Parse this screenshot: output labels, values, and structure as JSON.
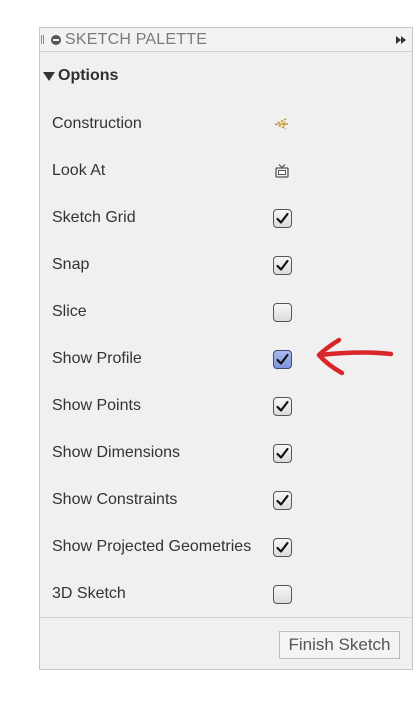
{
  "palette": {
    "title": "SKETCH PALETTE",
    "section_label": "Options",
    "rows": [
      {
        "label": "Construction",
        "control": "construction-icon",
        "checked": null
      },
      {
        "label": "Look At",
        "control": "look-at-icon",
        "checked": null
      },
      {
        "label": "Sketch Grid",
        "control": "checkbox",
        "checked": true
      },
      {
        "label": "Snap",
        "control": "checkbox",
        "checked": true
      },
      {
        "label": "Slice",
        "control": "checkbox",
        "checked": false
      },
      {
        "label": "Show Profile",
        "control": "checkbox",
        "checked": true,
        "highlighted": true
      },
      {
        "label": "Show Points",
        "control": "checkbox",
        "checked": true
      },
      {
        "label": "Show Dimensions",
        "control": "checkbox",
        "checked": true
      },
      {
        "label": "Show Constraints",
        "control": "checkbox",
        "checked": true
      },
      {
        "label": "Show Projected Geometries",
        "control": "checkbox",
        "checked": true
      },
      {
        "label": "3D Sketch",
        "control": "checkbox",
        "checked": false
      }
    ],
    "finish_label": "Finish Sketch"
  },
  "colors": {
    "annotation_arrow": "#d9262b",
    "construction_icon": "#c2861a",
    "checkbox_highlight": "#8da2e3"
  }
}
